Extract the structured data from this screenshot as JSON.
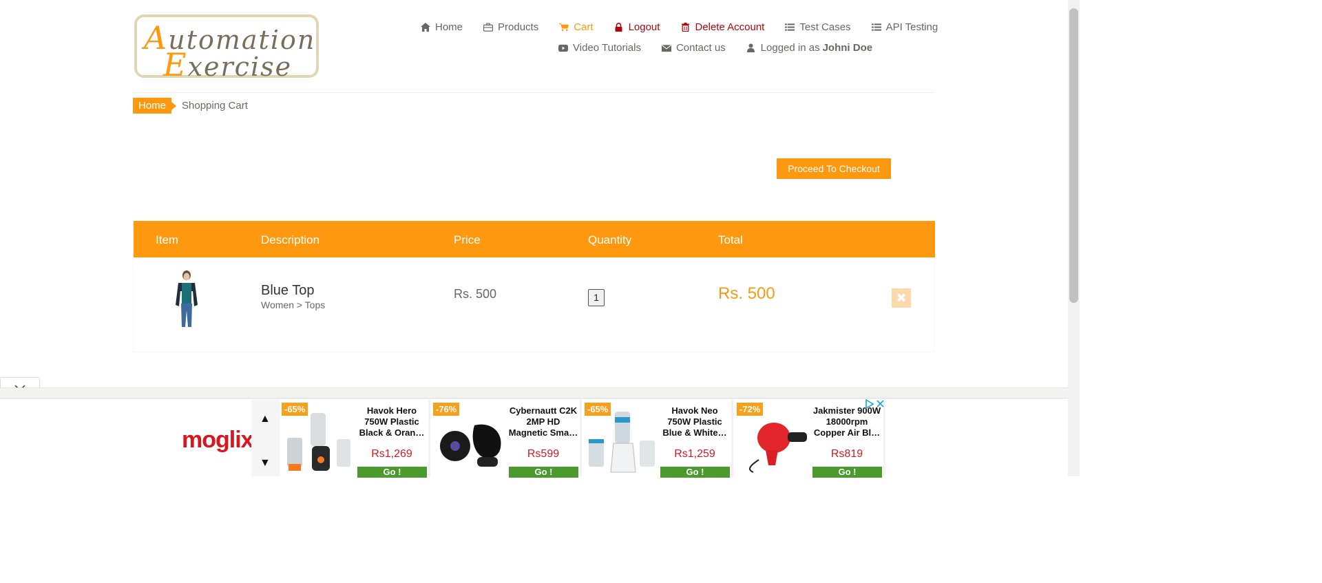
{
  "logo": {
    "line1_first": "A",
    "line1_rest": "utomation",
    "line2_first": "E",
    "line2_rest": "xercise"
  },
  "nav": {
    "home": "Home",
    "products": "Products",
    "cart": "Cart",
    "logout": "Logout",
    "delete_account": "Delete Account",
    "test_cases": "Test Cases",
    "api_testing": "API Testing",
    "video_tutorials": "Video Tutorials",
    "contact_us": "Contact us",
    "logged_in_prefix": "Logged in as",
    "logged_in_user": "Johni Doe"
  },
  "breadcrumb": {
    "home": "Home",
    "current": "Shopping Cart"
  },
  "checkout_button": "Proceed To Checkout",
  "table": {
    "headers": [
      "Item",
      "Description",
      "Price",
      "Quantity",
      "Total"
    ],
    "rows": [
      {
        "name": "Blue Top",
        "category": "Women > Tops",
        "price": "Rs. 500",
        "quantity": "1",
        "total": "Rs. 500"
      }
    ]
  },
  "ads": {
    "brand": "moglix",
    "items": [
      {
        "discount": "-65%",
        "title": "Havok Hero 750W Plastic Black & Oran…",
        "price": "Rs1,269",
        "cta": "Go !"
      },
      {
        "discount": "-76%",
        "title": "Cybernautt C2K 2MP HD Magnetic Sma…",
        "price": "Rs599",
        "cta": "Go !"
      },
      {
        "discount": "-65%",
        "title": "Havok Neo 750W Plastic Blue & White…",
        "price": "Rs1,259",
        "cta": "Go !"
      },
      {
        "discount": "-72%",
        "title": "Jakmister 900W 18000rpm Copper Air Bl…",
        "price": "Rs819",
        "cta": "Go !"
      }
    ]
  },
  "colors": {
    "accent": "#fe980f",
    "danger": "#b0060c",
    "ad_red": "#d9161e",
    "ad_green": "#4a9a2d"
  }
}
